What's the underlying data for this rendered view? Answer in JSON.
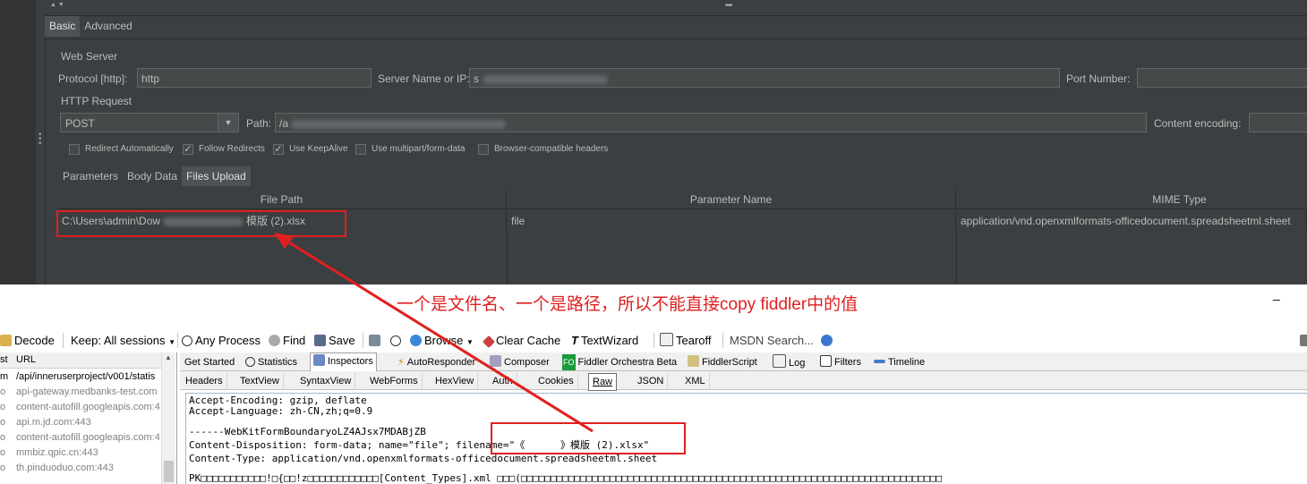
{
  "jmeter": {
    "tabs": [
      "Basic",
      "Advanced"
    ],
    "web_server": {
      "group_label": "Web Server",
      "protocol_label": "Protocol [http]:",
      "protocol_value": "http",
      "server_label": "Server Name or IP:",
      "server_value": "s",
      "port_label": "Port Number:",
      "port_value": ""
    },
    "http_request": {
      "group_label": "HTTP Request",
      "method": "POST",
      "path_label": "Path:",
      "path_value": "/a",
      "content_encoding_label": "Content encoding:",
      "content_encoding_value": ""
    },
    "checkboxes": [
      {
        "label": "Redirect Automatically",
        "checked": false
      },
      {
        "label": "Follow Redirects",
        "checked": true
      },
      {
        "label": "Use KeepAlive",
        "checked": true
      },
      {
        "label": "Use multipart/form-data",
        "checked": false
      },
      {
        "label": "Browser-compatible headers",
        "checked": false
      }
    ],
    "subtabs": [
      "Parameters",
      "Body Data",
      "Files Upload"
    ],
    "files_table": {
      "headers": [
        "File Path",
        "Parameter Name",
        "MIME Type"
      ],
      "rows": [
        {
          "file_path_start": "C:\\Users\\admin\\Dow",
          "file_path_end": "模版 (2).xlsx",
          "param": "file",
          "mime": "application/vnd.openxmlformats-officedocument.spreadsheetml.sheet"
        }
      ]
    }
  },
  "annotation": {
    "text": "一个是文件名、一个是路径，所以不能直接copy fiddler中的值",
    "color": "#e02020"
  },
  "fiddler": {
    "close_glyph": "_",
    "toolbar": {
      "decode": "Decode",
      "keep": "Keep: All sessions",
      "any_process": "Any Process",
      "find": "Find",
      "save": "Save",
      "browse": "Browse",
      "clear_cache": "Clear Cache",
      "textwizard": "TextWizard",
      "tearoff": "Tearoff",
      "msdn": "MSDN Search..."
    },
    "sessions": {
      "col1": "st",
      "col2": "URL",
      "rows": [
        {
          "c": "m",
          "url": "/api/inneruserproject/v001/statis",
          "dark": true
        },
        {
          "c": "o",
          "url": "api-gateway.medbanks-test.com",
          "dark": false
        },
        {
          "c": "o",
          "url": "content-autofill.googleapis.com:4",
          "dark": false
        },
        {
          "c": "o",
          "url": "api.m.jd.com:443",
          "dark": false
        },
        {
          "c": "o",
          "url": "content-autofill.googleapis.com:4",
          "dark": false
        },
        {
          "c": "o",
          "url": "mmbiz.qpic.cn:443",
          "dark": false
        },
        {
          "c": "o",
          "url": "th.pinduoduo.com:443",
          "dark": false
        }
      ]
    },
    "inspector_tabs": [
      "Get Started",
      "Statistics",
      "Inspectors",
      "AutoResponder",
      "Composer",
      "Fiddler Orchestra Beta",
      "FiddlerScript",
      "Log",
      "Filters",
      "Timeline"
    ],
    "request_tabs": [
      "Headers",
      "TextView",
      "SyntaxView",
      "WebForms",
      "HexView",
      "Auth",
      "Cookies",
      "Raw",
      "JSON",
      "XML"
    ],
    "raw_lines": [
      "Accept-Encoding: gzip, deflate",
      "Accept-Language: zh-CN,zh;q=0.9",
      "",
      "------WebKitFormBoundaryoLZ4AJsx7MDABjZB",
      "Content-Disposition: form-data; name=\"file\"; filename=\"《      》模版 (2).xlsx\"",
      "Content-Type: application/vnd.openxmlformats-officedocument.spreadsheetml.sheet",
      "",
      "PK□□□□□□□□□□□!□{□□!z□□□□□□□□□□□□[Content_Types].xml □□□(□□□□□□□□□□□□□□□□□□□□□□□□□□□□□□□□□□□□□□□□□□□□□□□□□□□□□□□□□□□□□□□□□□□□□□□"
    ]
  }
}
